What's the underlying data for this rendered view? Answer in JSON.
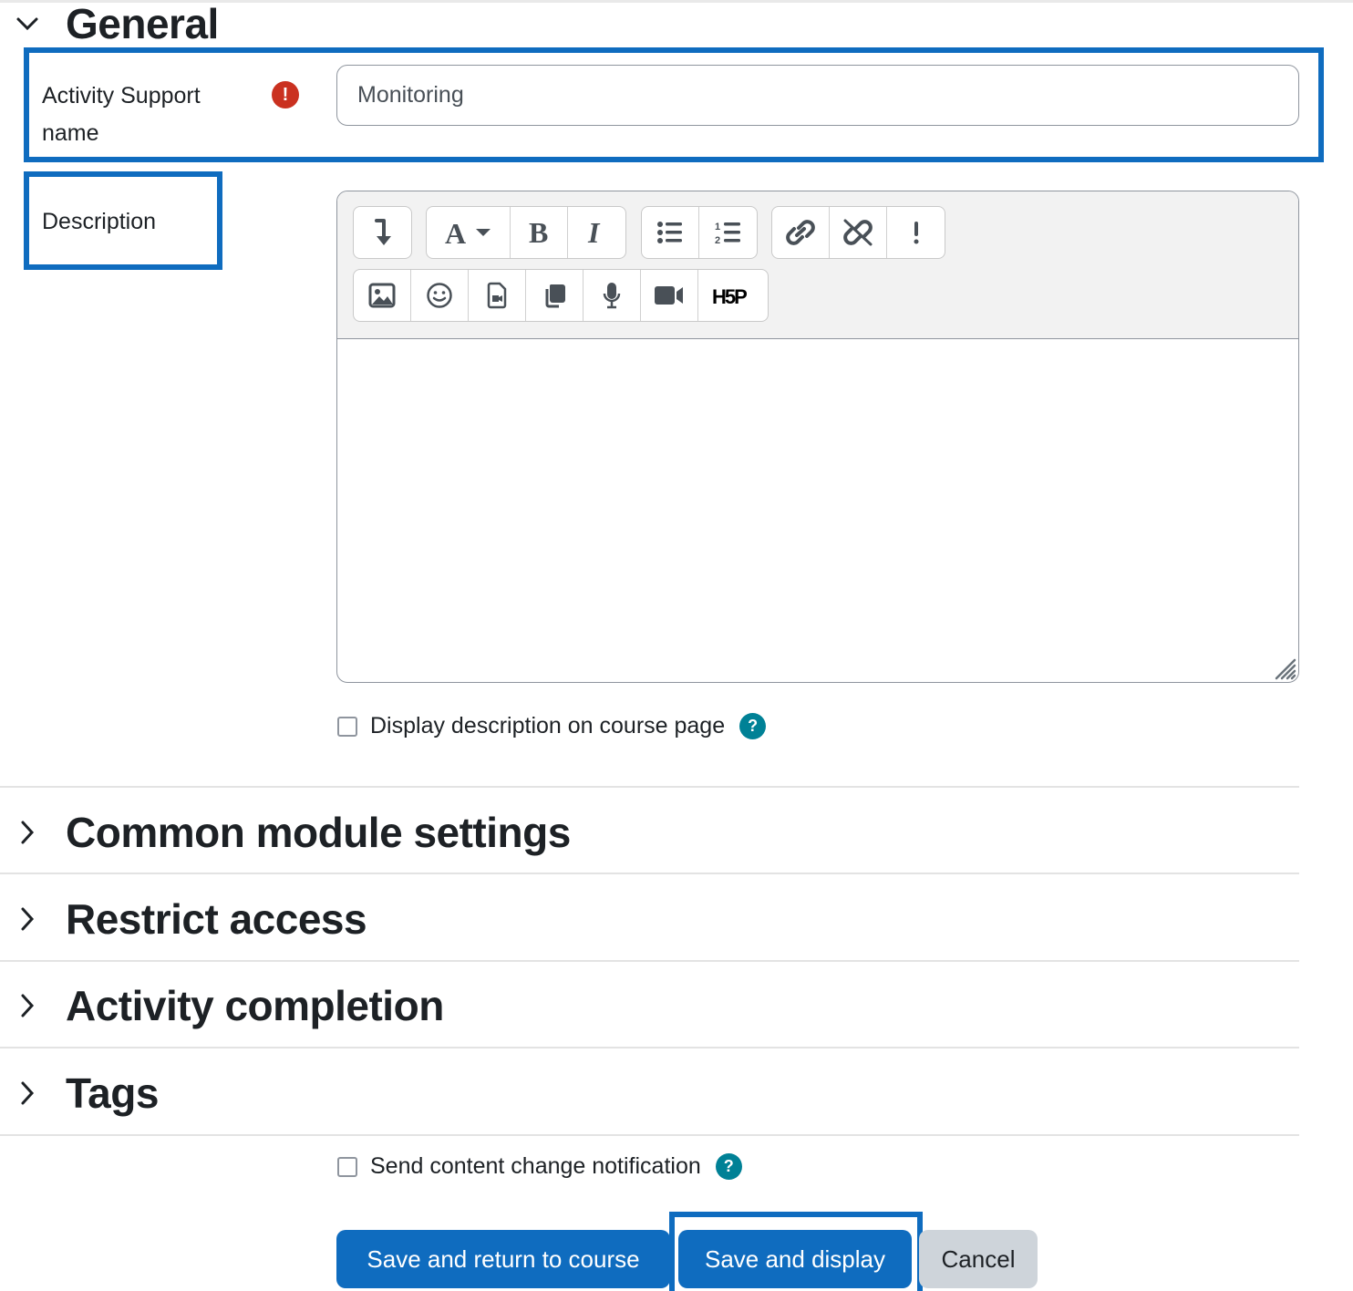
{
  "sections": {
    "general": {
      "title": "General",
      "expanded": true
    },
    "collapsed": [
      {
        "title": "Common module settings"
      },
      {
        "title": "Restrict access"
      },
      {
        "title": "Activity completion"
      },
      {
        "title": "Tags"
      }
    ]
  },
  "form": {
    "name_label": "Activity Support name",
    "name_label_line1": "Activity Support",
    "name_label_line2": "name",
    "name_required_icon": "exclamation-icon",
    "name_value": "Monitoring",
    "description_label": "Description",
    "editor_toolbar": {
      "row1": [
        [
          "collapse-toolbar-icon"
        ],
        [
          "font-style-icon",
          "bold-icon",
          "italic-icon"
        ],
        [
          "bulleted-list-icon",
          "numbered-list-icon"
        ],
        [
          "link-icon",
          "unlink-icon",
          "accessibility-checker-icon"
        ]
      ],
      "row2": [
        [
          "insert-image-icon",
          "emoji-icon",
          "media-icon",
          "manage-files-icon",
          "record-audio-icon",
          "record-video-icon",
          "h5p-icon"
        ]
      ]
    },
    "display_description_label": "Display description on course page",
    "display_description_checked": false,
    "send_notification_label": "Send content change notification",
    "send_notification_checked": false
  },
  "buttons": {
    "save_return": "Save and return to course",
    "save_display": "Save and display",
    "cancel": "Cancel"
  },
  "colors": {
    "primary": "#0f6cbf",
    "highlight": "#0f6cbf",
    "required": "#ca3120",
    "help": "#008196",
    "secondary": "#ced4da"
  }
}
